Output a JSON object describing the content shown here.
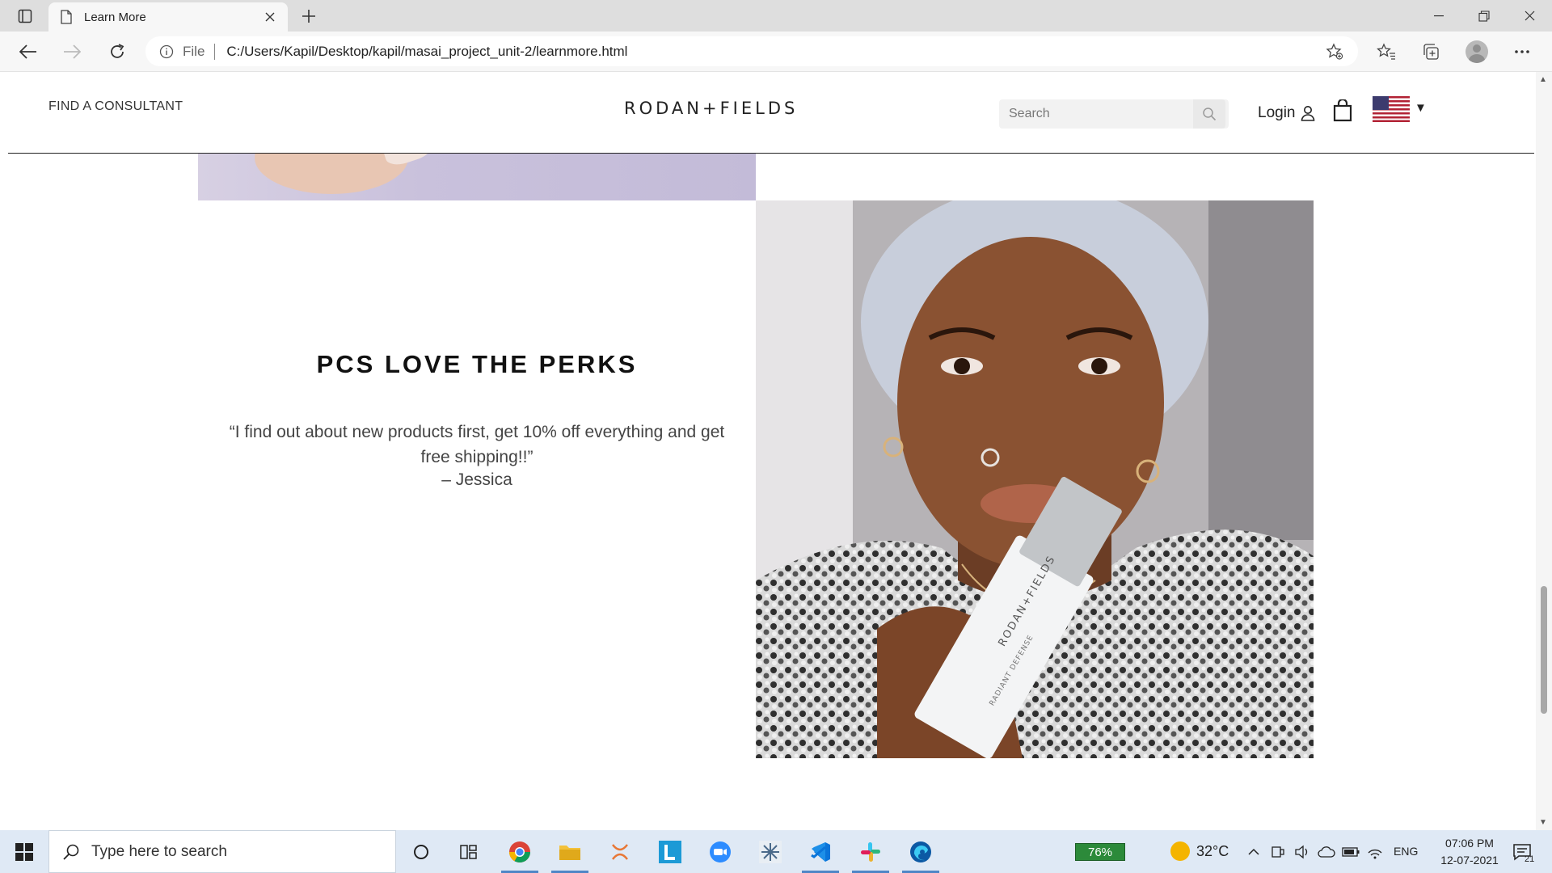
{
  "browser": {
    "tab_title": "Learn More",
    "address_prefix": "File",
    "url": "C:/Users/Kapil/Desktop/kapil/masai_project_unit-2/learnmore.html"
  },
  "site": {
    "find_consultant": "FIND A CONSULTANT",
    "logo": "RODAN+FIELDS",
    "search_placeholder": "Search",
    "login_label": "Login",
    "country_caret": "▼"
  },
  "perks": {
    "title": "PCS LOVE THE PERKS",
    "quote": "“I find out about new products first, get 10% off everything and get free shipping!!”",
    "author": "– Jessica"
  },
  "photo": {
    "bottle_brand": "RODAN+FIELDS",
    "bottle_product": "RADIANT DEFENSE"
  },
  "taskbar": {
    "search_placeholder": "Type here to search",
    "battery": "76%",
    "temperature": "32°C",
    "language": "ENG",
    "time": "07:06 PM",
    "date": "12-07-2021",
    "notification_count": "21"
  },
  "colors": {
    "accent_edge": "#0a74d9",
    "taskbar_bg": "#dfe9f5",
    "battery_green": "#2c8a3a",
    "header_rule": "#222222"
  }
}
